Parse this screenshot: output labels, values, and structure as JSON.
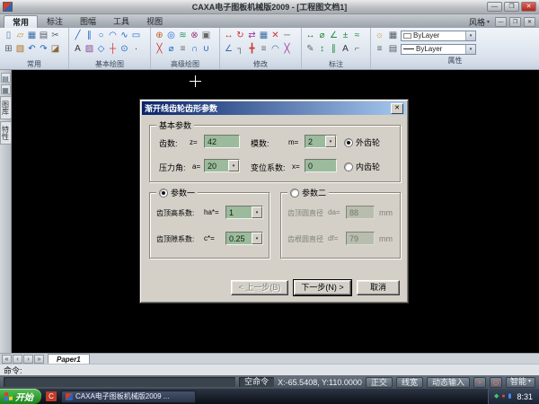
{
  "window": {
    "title": "CAXA电子图板机械版2009 - [工程图文档1]",
    "min": "—",
    "max": "❐",
    "close": "✕"
  },
  "ribbon": {
    "tabs": [
      {
        "label": "常用"
      },
      {
        "label": "标注"
      },
      {
        "label": "图幅"
      },
      {
        "label": "工具"
      },
      {
        "label": "视图"
      }
    ],
    "style_button": "风格",
    "arrow": "▾",
    "mdi": {
      "min": "—",
      "restore": "❐",
      "close": "✕"
    },
    "bylayer1": "ByLayer",
    "bylayer2": "ByLayer",
    "groups": [
      {
        "label": "常用",
        "icons": [
          {
            "name": "new-file-icon",
            "glyph": "▯",
            "css": "color:#5a7a9a"
          },
          {
            "name": "open-file-icon",
            "glyph": "▱",
            "css": "color:#c89020"
          },
          {
            "name": "save-icon",
            "glyph": "▦",
            "css": "color:#3a6ea5"
          },
          {
            "name": "print-icon",
            "glyph": "▤",
            "css": "color:#555d66"
          },
          {
            "name": "cut-icon",
            "glyph": "✂",
            "css": "color:#555d66"
          },
          {
            "name": "copy-icon",
            "glyph": "⊞",
            "css": "color:#555d66"
          },
          {
            "name": "paste-icon",
            "glyph": "▧",
            "css": "color:#b07020"
          },
          {
            "name": "undo-icon",
            "glyph": "↶",
            "css": "color:#2060c0"
          },
          {
            "name": "redo-icon",
            "glyph": "↷",
            "css": "color:#2060c0"
          },
          {
            "name": "format-brush-icon",
            "glyph": "◪",
            "css": "color:#8a6a3a"
          }
        ]
      },
      {
        "label": "基本绘图",
        "icons": [
          {
            "name": "line-icon",
            "glyph": "╱",
            "css": "color:#1a66cc"
          },
          {
            "name": "parallel-line-icon",
            "glyph": "∥",
            "css": "color:#1a66cc"
          },
          {
            "name": "circle-icon",
            "glyph": "○",
            "css": "color:#1a66cc"
          },
          {
            "name": "arc-icon",
            "glyph": "◠",
            "css": "color:#1a66cc"
          },
          {
            "name": "spline-icon",
            "glyph": "∿",
            "css": "color:#1a66cc"
          },
          {
            "name": "rectangle-icon",
            "glyph": "▭",
            "css": "color:#1a66cc"
          },
          {
            "name": "text-icon",
            "glyph": "A",
            "css": "color:#333333"
          },
          {
            "name": "hatch-icon",
            "glyph": "▨",
            "css": "color:#8a4a9a"
          },
          {
            "name": "polygon-icon",
            "glyph": "◇",
            "css": "color:#1a66cc"
          },
          {
            "name": "centerline-icon",
            "glyph": "┼",
            "css": "color:#cc3333"
          },
          {
            "name": "ellipse-icon",
            "glyph": "⊙",
            "css": "color:#1a66cc"
          },
          {
            "name": "point-icon",
            "glyph": "·",
            "css": "color:#333333"
          }
        ]
      },
      {
        "label": "高级绘图",
        "icons": [
          {
            "name": "wheel-icon",
            "glyph": "⊕",
            "css": "color:#c06020"
          },
          {
            "name": "concentric-icon",
            "glyph": "◎",
            "css": "color:#1a66cc"
          },
          {
            "name": "wave-icon",
            "glyph": "≋",
            "css": "color:#2a9a6a"
          },
          {
            "name": "gear-draw-icon",
            "glyph": "⊗",
            "css": "color:#9a3a7a"
          },
          {
            "name": "block-icon",
            "glyph": "▣",
            "css": "color:#666666"
          },
          {
            "name": "cross-icon",
            "glyph": "╳",
            "css": "color:#cc3333"
          },
          {
            "name": "diameter-icon",
            "glyph": "⌀",
            "css": "color:#1a66cc"
          },
          {
            "name": "table-icon",
            "glyph": "≡",
            "css": "color:#666666"
          },
          {
            "name": "contour-icon",
            "glyph": "∩",
            "css": "color:#1a66cc"
          },
          {
            "name": "curve-icon",
            "glyph": "∪",
            "css": "color:#1a66cc"
          }
        ]
      },
      {
        "label": "修改",
        "icons": [
          {
            "name": "move-icon",
            "glyph": "↔",
            "css": "color:#cc3333"
          },
          {
            "name": "rotate-icon",
            "glyph": "↻",
            "css": "color:#cc3333"
          },
          {
            "name": "mirror-icon",
            "glyph": "⇄",
            "css": "color:#9a3a9a"
          },
          {
            "name": "array-icon",
            "glyph": "▦",
            "css": "color:#3a6ea5"
          },
          {
            "name": "delete-icon",
            "glyph": "✕",
            "css": "color:#cc3333"
          },
          {
            "name": "stretch-icon",
            "glyph": "─",
            "css": "color:#666666"
          },
          {
            "name": "chamfer-icon",
            "glyph": "∠",
            "css": "color:#3a6ea5"
          },
          {
            "name": "corner-icon",
            "glyph": "┐",
            "css": "color:#666666"
          },
          {
            "name": "break-icon",
            "glyph": "╋",
            "css": "color:#cc3333"
          },
          {
            "name": "explode-icon",
            "glyph": "≡",
            "css": "color:#666666"
          },
          {
            "name": "fillet-icon",
            "glyph": "◠",
            "css": "color:#3a6ea5"
          },
          {
            "name": "trim-icon",
            "glyph": "╳",
            "css": "color:#9a3a9a"
          }
        ]
      },
      {
        "label": "标注",
        "icons": [
          {
            "name": "dimension-icon",
            "glyph": "↔",
            "css": "color:#1a8a3a"
          },
          {
            "name": "diameter-dim-icon",
            "glyph": "⌀",
            "css": "color:#1a8a3a"
          },
          {
            "name": "angle-dim-icon",
            "glyph": "∠",
            "css": "color:#1a8a3a"
          },
          {
            "name": "tolerance-icon",
            "glyph": "±",
            "css": "color:#1a8a3a"
          },
          {
            "name": "roughness-icon",
            "glyph": "≈",
            "css": "color:#1a8a3a"
          },
          {
            "name": "edit-dim-icon",
            "glyph": "✎",
            "css": "color:#666666"
          },
          {
            "name": "vertical-dim-icon",
            "glyph": "↕",
            "css": "color:#1a8a3a"
          },
          {
            "name": "parallel-dim-icon",
            "glyph": "∥",
            "css": "color:#1a8a3a"
          },
          {
            "name": "dim-text-icon",
            "glyph": "A",
            "css": "color:#333333"
          },
          {
            "name": "leader-icon",
            "glyph": "⌐",
            "css": "color:#666666"
          }
        ]
      },
      {
        "label": "属性",
        "icons_row1": [
          {
            "name": "layer-on-icon",
            "glyph": "☼",
            "css": "color:#c89020"
          },
          {
            "name": "layer-settings-icon",
            "glyph": "▦",
            "css": "color:#555d66"
          }
        ],
        "icons_row2": [
          {
            "name": "layers-icon",
            "glyph": "≡",
            "css": "color:#555d66"
          },
          {
            "name": "match-properties-icon",
            "glyph": "▤",
            "css": "color:#555d66"
          }
        ]
      }
    ]
  },
  "left_panel": {
    "icons": [
      {
        "name": "palette-icon",
        "glyph": "▤",
        "css": "color:#4a5a6a"
      },
      {
        "name": "library-icon",
        "glyph": "▦",
        "css": "color:#4a5a6a"
      }
    ],
    "tabs": [
      {
        "label": "图库"
      },
      {
        "label": "特性"
      }
    ]
  },
  "dialog": {
    "title": "渐开线齿轮齿形参数",
    "close": "✕",
    "basic_group": {
      "label": "基本参数",
      "teeth": {
        "label": "齿数:",
        "symbol": "z=",
        "value": "42"
      },
      "module": {
        "label": "模数:",
        "symbol": "m=",
        "value": "2"
      },
      "pressure_angle": {
        "label": "压力角:",
        "symbol": "a=",
        "value": "20"
      },
      "shift_coeff": {
        "label": "变位系数:",
        "symbol": "x=",
        "value": "0"
      },
      "external": "外齿轮",
      "internal": "内齿轮"
    },
    "param1_group": {
      "label": "参数一",
      "addendum": {
        "label": "齿顶高系数:",
        "symbol": "ha*=",
        "value": "1"
      },
      "clearance": {
        "label": "齿顶隙系数:",
        "symbol": "c*=",
        "value": "0.25"
      }
    },
    "param2_group": {
      "label": "参数二",
      "tip_dia": {
        "label": "齿顶圆直径",
        "symbol": "da=",
        "value": "88",
        "unit": "mm"
      },
      "root_dia": {
        "label": "齿根圆直径",
        "symbol": "df=",
        "value": "79",
        "unit": "mm"
      }
    },
    "buttons": {
      "back": "< 上一步(B)",
      "next": "下一步(N) >",
      "cancel": "取消"
    }
  },
  "bottom": {
    "nav": [
      "«",
      "‹",
      "›",
      "»"
    ],
    "paper_tab": "Paper1",
    "command_label": "命令:"
  },
  "status": {
    "message": "空命令",
    "coords": "X:-65.5408, Y:110.0000",
    "toggles": [
      "正交",
      "线宽",
      "动态输入"
    ],
    "icon_buttons": [
      {
        "name": "snap-point-icon",
        "glyph": "+",
        "css": "color:#ff6a5a"
      },
      {
        "name": "snap-target-icon",
        "glyph": "⊙",
        "css": "color:#ff6a5a"
      }
    ],
    "mode": "智能",
    "mode_arrow": "▾"
  },
  "taskbar": {
    "start_label": "开始",
    "quick_label": "C",
    "task_label": "CAXA电子图板机械版2009 ...",
    "tray_icons": [
      {
        "name": "tray-antivirus-icon",
        "glyph": "◆",
        "css": "color:#3cc96a"
      },
      {
        "name": "tray-volume-icon",
        "glyph": "●",
        "css": "color:#d85040"
      },
      {
        "name": "tray-network-icon",
        "glyph": "▮",
        "css": "color:#4a90ff"
      }
    ],
    "clock": "8:31"
  }
}
